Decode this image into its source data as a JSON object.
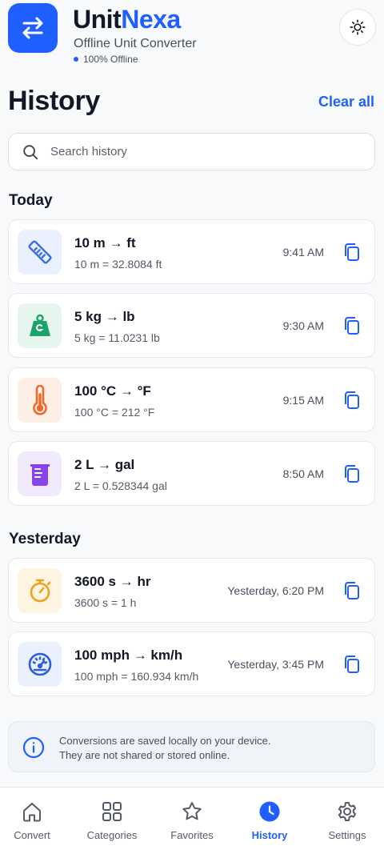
{
  "header": {
    "brand_part1": "Unit",
    "brand_part2": "Nexa",
    "subtitle": "Offline Unit Converter",
    "status": "100% Offline",
    "logo_icon": "swap-arrows-icon",
    "theme_icon": "sun-icon"
  },
  "page": {
    "title": "History",
    "clear_all": "Clear all"
  },
  "search": {
    "placeholder": "Search history",
    "value": ""
  },
  "sections": {
    "today": "Today",
    "yesterday": "Yesterday"
  },
  "history": [
    {
      "title": "10 m → ft",
      "result": "10 m = 32.8084 ft",
      "time": "9:41 AM",
      "icon": "ruler-icon",
      "color": "#3b6fe0",
      "bg": "#eaf0fd"
    },
    {
      "title": "5 kg → lb",
      "result": "5 kg = 11.0231 lb",
      "time": "9:30 AM",
      "icon": "weight-icon",
      "color": "#1aa36b",
      "bg": "#e6f6ef"
    },
    {
      "title": "100 °C → °F",
      "result": "100 °C = 212 °F",
      "time": "9:15 AM",
      "icon": "thermometer-icon",
      "color": "#ec6a2c",
      "bg": "#fdeee6"
    },
    {
      "title": "2 L → gal",
      "result": "2 L = 0.528344 gal",
      "time": "8:50 AM",
      "icon": "beaker-icon",
      "color": "#8a43e8",
      "bg": "#f1eafd"
    },
    {
      "title": "3600 s → hr",
      "result": "3600 s = 1 h",
      "time": "Yesterday, 6:20 PM",
      "icon": "stopwatch-icon",
      "color": "#f0a21c",
      "bg": "#fdf4e2"
    },
    {
      "title": "100 mph → km/h",
      "result": "100 mph = 160.934 km/h",
      "time": "Yesterday, 3:45 PM",
      "icon": "speedometer-icon",
      "color": "#2a5fd8",
      "bg": "#eaf0fd"
    }
  ],
  "info": {
    "line1": "Conversions are saved locally on your device.",
    "line2": "They are not shared or stored online.",
    "icon": "info-icon"
  },
  "nav": [
    {
      "label": "Convert",
      "icon": "home-icon"
    },
    {
      "label": "Categories",
      "icon": "grid-icon"
    },
    {
      "label": "Favorites",
      "icon": "star-icon"
    },
    {
      "label": "History",
      "icon": "clock-icon",
      "active": true
    },
    {
      "label": "Settings",
      "icon": "gear-icon"
    }
  ],
  "colors": {
    "accent": "#1f5eff",
    "text": "#141726",
    "muted": "#555a66"
  }
}
